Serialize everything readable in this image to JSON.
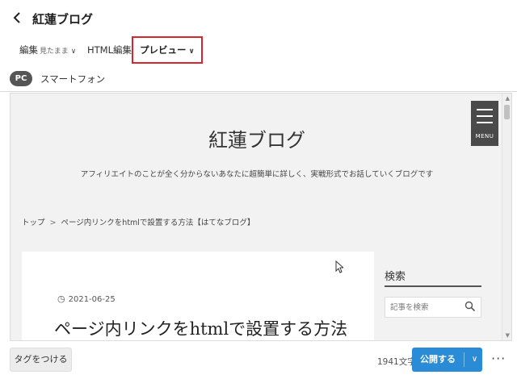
{
  "header": {
    "back_icon": "chevron-left-icon",
    "back_glyph": "く",
    "title": "紅蓮ブログ"
  },
  "tabs": {
    "edit_label": "編集",
    "edit_sub": "見たまま",
    "html_label": "HTML編集",
    "preview_label": "プレビュー",
    "chevron": "∨"
  },
  "devices": {
    "pc_label": "PC",
    "smartphone_label": "スマートフォン"
  },
  "preview": {
    "menu_label": "MENU",
    "blog_title": "紅蓮ブログ",
    "blog_description": "アフィリエイトのことが全く分からないあなたに超簡単に詳しく、実戦形式でお話していくブログです",
    "breadcrumb": {
      "home": "トップ",
      "separator": ">",
      "current": "ページ内リンクをhtmlで設置する方法【はてなブログ】"
    },
    "article": {
      "date": "2021-06-25",
      "title": "ページ内リンクをhtmlで設置する方法"
    },
    "sidebar": {
      "search_heading": "検索",
      "search_placeholder": "記事を検索"
    }
  },
  "footer": {
    "tag_button": "タグをつける",
    "char_count": "1941文字",
    "publish_label": "公開する",
    "more_glyph": "···"
  },
  "colors": {
    "accent": "#2a8cd6",
    "highlight_border": "#d9262c",
    "menu_bg": "#4a4a4a"
  }
}
